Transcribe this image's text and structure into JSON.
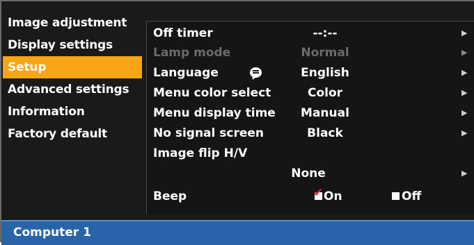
{
  "sidebar": {
    "items": [
      {
        "label": "Image adjustment",
        "active": false
      },
      {
        "label": "Display settings",
        "active": false
      },
      {
        "label": "Setup",
        "active": true
      },
      {
        "label": "Advanced settings",
        "active": false
      },
      {
        "label": "Information",
        "active": false
      },
      {
        "label": "Factory default",
        "active": false
      }
    ]
  },
  "setup": {
    "off_timer": {
      "label": "Off timer",
      "value": "--:--"
    },
    "lamp_mode": {
      "label": "Lamp mode",
      "value": "Normal",
      "disabled": true
    },
    "language": {
      "label": "Language",
      "value": "English",
      "icon": "speech-bubble-icon"
    },
    "menu_color": {
      "label": "Menu color select",
      "value": "Color"
    },
    "menu_time": {
      "label": "Menu display time",
      "value": "Manual"
    },
    "no_signal": {
      "label": "No signal screen",
      "value": "Black"
    },
    "image_flip": {
      "label": "Image flip H/V",
      "value": "None"
    },
    "beep": {
      "label": "Beep",
      "on_label": "On",
      "off_label": "Off",
      "selected": "On"
    }
  },
  "arrow_glyph": "▶",
  "footer": {
    "source": "Computer 1"
  },
  "colors": {
    "accent": "#f7a415",
    "footer": "#2a64a8",
    "background": "#1a1a1a",
    "checkmark": "#e0202a"
  }
}
